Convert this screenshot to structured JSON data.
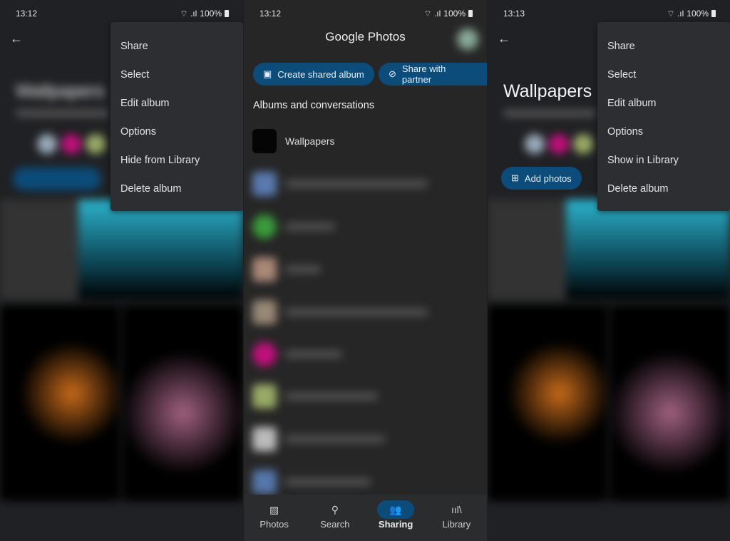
{
  "left": {
    "time": "13:12",
    "battery": "100%",
    "menu": [
      "Share",
      "Select",
      "Edit album",
      "Options",
      "Hide from Library",
      "Delete album"
    ],
    "title": "Wallpapers"
  },
  "middle": {
    "time": "13:12",
    "battery": "100%",
    "app_title": "Google Photos",
    "buttons": {
      "create": "Create shared album",
      "partner": "Share with partner"
    },
    "section": "Albums and conversations",
    "first_item": "Wallpapers",
    "nav": [
      {
        "label": "Photos",
        "icon": "photo-icon"
      },
      {
        "label": "Search",
        "icon": "search-icon"
      },
      {
        "label": "Sharing",
        "icon": "people-icon",
        "active": true
      },
      {
        "label": "Library",
        "icon": "library-icon"
      }
    ]
  },
  "right": {
    "time": "13:13",
    "battery": "100%",
    "title": "Wallpapers",
    "add_photos": "Add photos",
    "menu": [
      "Share",
      "Select",
      "Edit album",
      "Options",
      "Show in Library",
      "Delete album"
    ]
  },
  "colors": {
    "accent": "#0b4c7a",
    "menu_bg": "#2d2e31"
  }
}
